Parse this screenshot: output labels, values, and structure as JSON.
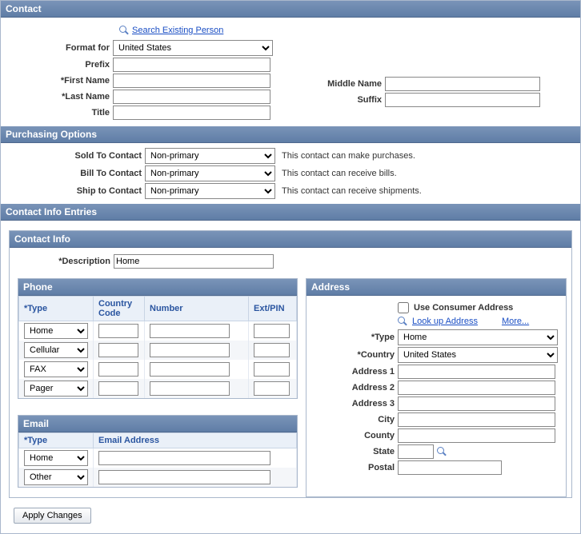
{
  "contact": {
    "title": "Contact",
    "search_link": "Search Existing Person",
    "format_for_label": "Format for",
    "format_for_value": "United States",
    "prefix_label": "Prefix",
    "prefix_value": "",
    "first_name_label": "*First Name",
    "first_name_value": "",
    "middle_name_label": "Middle Name",
    "middle_name_value": "",
    "last_name_label": "*Last Name",
    "last_name_value": "",
    "suffix_label": "Suffix",
    "suffix_value": "",
    "title_label": "Title",
    "title_value": ""
  },
  "purchasing": {
    "title": "Purchasing Options",
    "sold_label": "Sold To Contact",
    "sold_value": "Non-primary",
    "sold_hint": "This contact can make purchases.",
    "bill_label": "Bill To Contact",
    "bill_value": "Non-primary",
    "bill_hint": "This contact can receive bills.",
    "ship_label": "Ship to Contact",
    "ship_value": "Non-primary",
    "ship_hint": "This contact can receive shipments."
  },
  "cie": {
    "title": "Contact Info Entries",
    "ci_title": "Contact Info",
    "desc_label": "*Description",
    "desc_value": "Home",
    "phone_title": "Phone",
    "phone_cols": {
      "type": "*Type",
      "cc": "Country Code",
      "number": "Number",
      "ext": "Ext/PIN"
    },
    "phone_rows": [
      {
        "type": "Home",
        "cc": "",
        "number": "",
        "ext": ""
      },
      {
        "type": "Cellular",
        "cc": "",
        "number": "",
        "ext": ""
      },
      {
        "type": "FAX",
        "cc": "",
        "number": "",
        "ext": ""
      },
      {
        "type": "Pager",
        "cc": "",
        "number": "",
        "ext": ""
      }
    ],
    "email_title": "Email",
    "email_cols": {
      "type": "*Type",
      "addr": "Email Address"
    },
    "email_rows": [
      {
        "type": "Home",
        "addr": ""
      },
      {
        "type": "Other",
        "addr": ""
      }
    ],
    "addr_title": "Address",
    "use_consumer": "Use Consumer Address",
    "lookup": "Look up Address",
    "more": "More...",
    "addr_type_label": "*Type",
    "addr_type_value": "Home",
    "country_label": "*Country",
    "country_value": "United States",
    "addr1_label": "Address 1",
    "addr1_value": "",
    "addr2_label": "Address 2",
    "addr2_value": "",
    "addr3_label": "Address 3",
    "addr3_value": "",
    "city_label": "City",
    "city_value": "",
    "county_label": "County",
    "county_value": "",
    "state_label": "State",
    "state_value": "",
    "postal_label": "Postal",
    "postal_value": ""
  },
  "apply_changes": "Apply Changes"
}
